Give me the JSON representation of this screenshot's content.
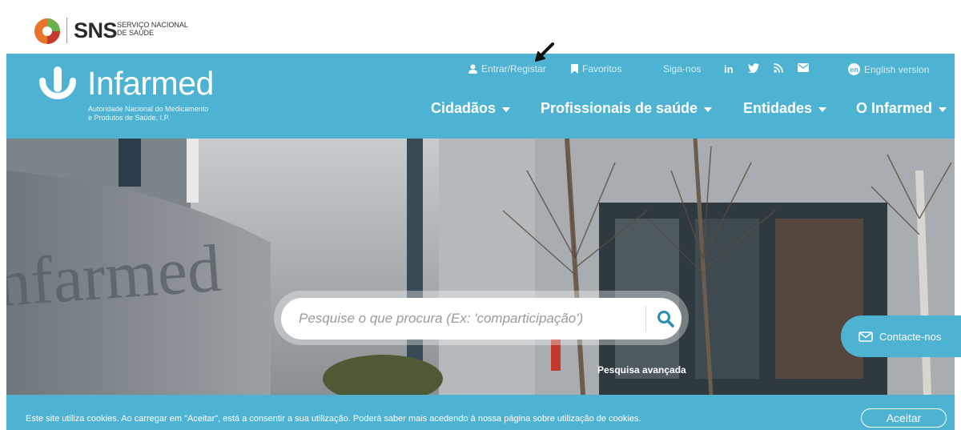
{
  "sns": {
    "wordmark": "SNS",
    "subtitle_line1": "SERVIÇO NACIONAL",
    "subtitle_line2": "DE SAÚDE"
  },
  "brand": {
    "name": "Infarmed",
    "subtitle_line1": "Autoridade Nacional do Medicamento",
    "subtitle_line2": "e Produtos de Saúde, I.P."
  },
  "utility": {
    "signin": "Entrar/Registar",
    "favorites": "Favoritos",
    "follow": "Siga-nos",
    "social": [
      "in",
      "twitter",
      "rss",
      "email"
    ],
    "language_badge": "en",
    "language": "English version"
  },
  "nav": [
    {
      "label": "Cidadãos"
    },
    {
      "label": "Profissionais de saúde"
    },
    {
      "label": "Entidades"
    },
    {
      "label": "O Infarmed"
    }
  ],
  "search": {
    "placeholder": "Pesquise o que procura (Ex: 'comparticipação')",
    "advanced": "Pesquisa avançada"
  },
  "hero": {
    "wall_text": "nfarmed"
  },
  "contact": {
    "label": "Contacte-nos"
  },
  "cookie": {
    "text": "Este site utiliza cookies. Ao carregar em \"Aceitar\", está a consentir a sua utilização. Poderá saber mais acedendo à nossa página sobre utilização de cookies.",
    "accept": "Aceitar"
  },
  "colors": {
    "brand": "#4eb3d3",
    "white": "#ffffff"
  }
}
